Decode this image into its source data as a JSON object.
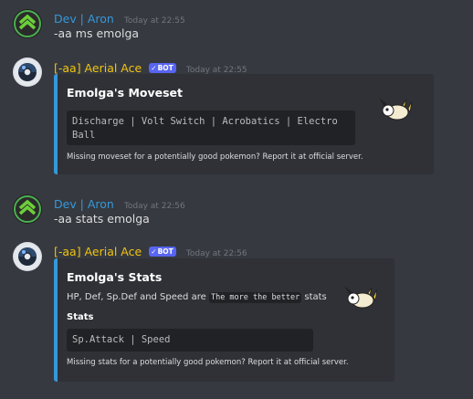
{
  "messages": [
    {
      "username": "Dev | Aron",
      "timestamp": "Today at 22:55",
      "content": "-aa ms emolga"
    },
    {
      "username": "[-aa] Aerial Ace",
      "bot_tag": "BOT",
      "timestamp": "Today at 22:55",
      "embed": {
        "title": "Emolga's Moveset",
        "code": "Discharge | Volt Switch | Acrobatics | Electro Ball",
        "footer": "Missing moveset for a potentially good pokemon? Report it at official server."
      }
    },
    {
      "username": "Dev | Aron",
      "timestamp": "Today at 22:56",
      "content": "-aa stats emolga"
    },
    {
      "username": "[-aa] Aerial Ace",
      "bot_tag": "BOT",
      "timestamp": "Today at 22:56",
      "embed": {
        "title": "Emolga's Stats",
        "description_before": "HP, Def, Sp.Def and Speed are",
        "description_code": "The more the better",
        "description_after": "stats",
        "field_name": "Stats",
        "code": "Sp.Attack | Speed",
        "footer": "Missing stats for a potentially good pokemon? Report it at official server."
      }
    }
  ],
  "icons": {
    "dev_avatar": "green-chevron-emblem-icon",
    "bot_avatar": "pokeball-icon",
    "bot_tag_check": "checkmark-icon",
    "embed_thumbnail": "emolga-sprite-icon"
  },
  "colors": {
    "background": "#36393f",
    "embed_background": "#2f3136",
    "embed_accent": "#3498db",
    "dev_username": "#3498db",
    "bot_username": "#f1c40f",
    "bot_tag": "#5865f2"
  }
}
